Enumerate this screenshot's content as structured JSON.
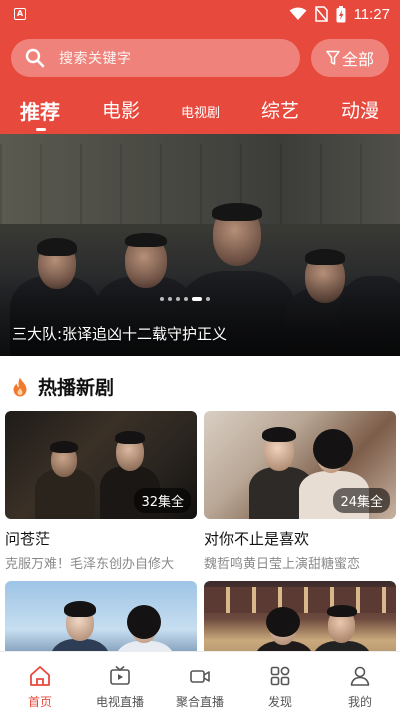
{
  "status_bar": {
    "app_badge": "A",
    "time": "11:27"
  },
  "search": {
    "placeholder": "搜索关键字",
    "filter_label": "全部"
  },
  "tabs": [
    {
      "label": "推荐",
      "active": true
    },
    {
      "label": "电影"
    },
    {
      "label": "电视剧"
    },
    {
      "label": "综艺"
    },
    {
      "label": "动漫"
    }
  ],
  "banner": {
    "caption": "三大队:张译追凶十二载守护正义",
    "dot_count": 6,
    "active_dot": 4
  },
  "section": {
    "title": "热播新剧",
    "icon": "flame-icon"
  },
  "cards": [
    {
      "title": "问苍茫",
      "subtitle": "克服万难！毛泽东创办自修大",
      "badge": "32集全"
    },
    {
      "title": "对你不止是喜欢",
      "subtitle": "魏哲鸣黄日莹上演甜糖蜜恋",
      "badge": "24集全"
    },
    {
      "title": "",
      "subtitle": "",
      "badge": ""
    },
    {
      "title": "",
      "subtitle": "",
      "badge": ""
    }
  ],
  "bottom_nav": [
    {
      "label": "首页",
      "icon": "home-icon",
      "active": true
    },
    {
      "label": "电视直播",
      "icon": "tv-icon"
    },
    {
      "label": "聚合直播",
      "icon": "video-camera-icon"
    },
    {
      "label": "发现",
      "icon": "discover-grid-icon"
    },
    {
      "label": "我的",
      "icon": "user-icon"
    }
  ],
  "colors": {
    "accent": "#e8493d",
    "text_primary": "#111111",
    "text_secondary": "#8a8a8a"
  }
}
